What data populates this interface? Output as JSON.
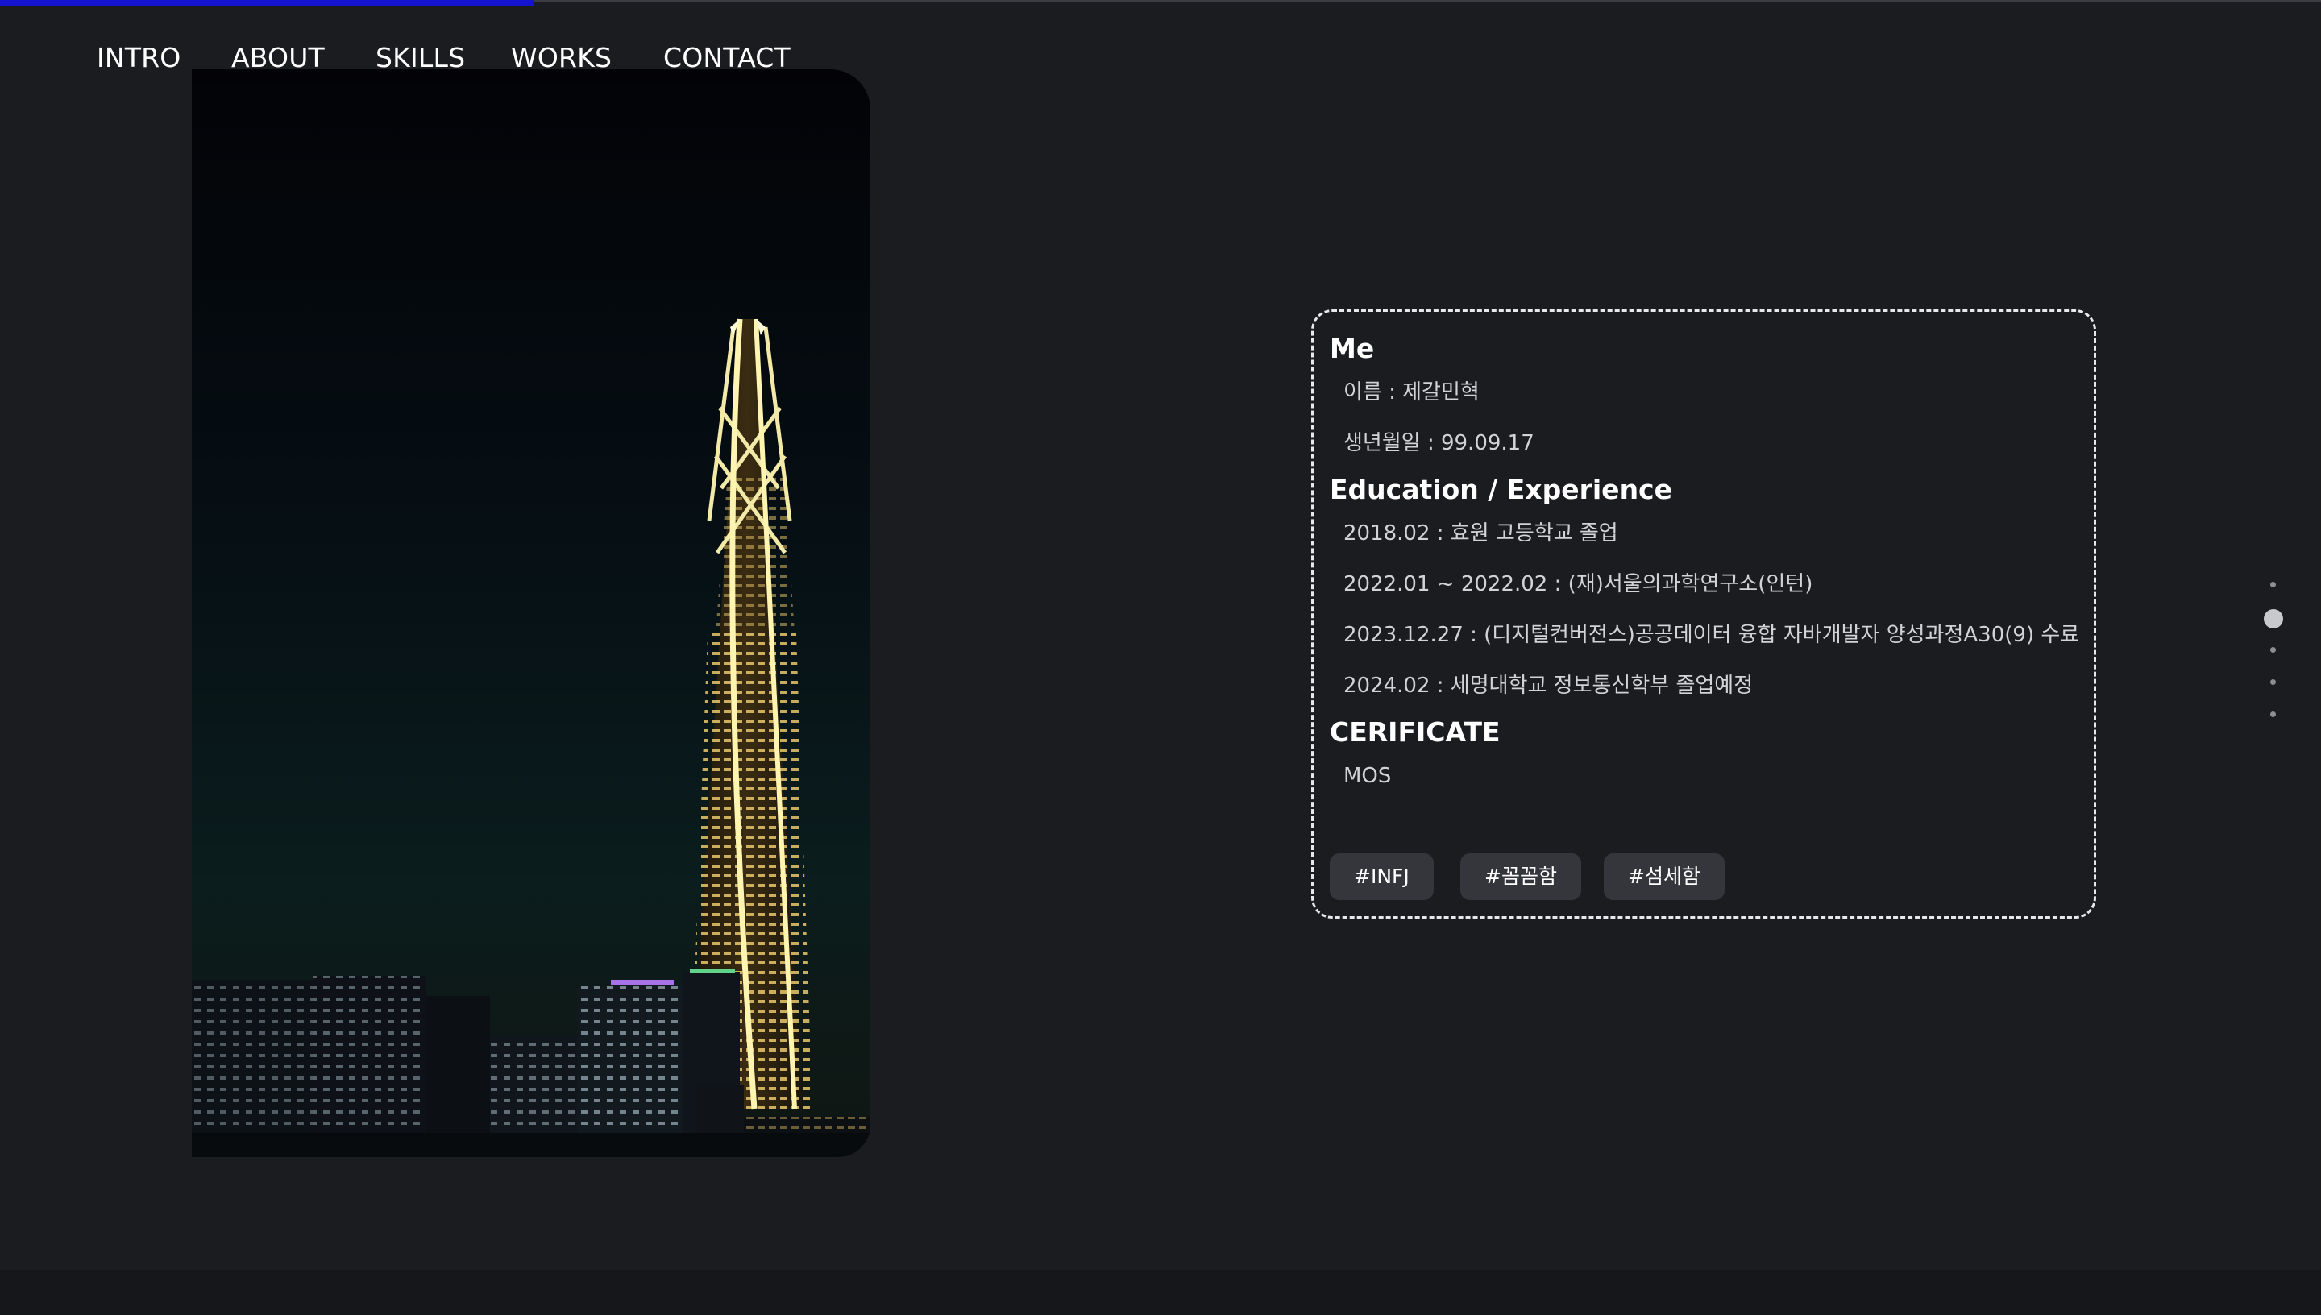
{
  "progress": {
    "value_percent": 23,
    "color": "#1414d0"
  },
  "nav": {
    "items": [
      {
        "label": "INTRO",
        "active": false
      },
      {
        "label": "ABOUT",
        "active": true
      },
      {
        "label": "SKILLS",
        "active": false
      },
      {
        "label": "WORKS",
        "active": false
      },
      {
        "label": "CONTACT",
        "active": false
      }
    ]
  },
  "photo": {
    "icon": "night-skyline-photo"
  },
  "about": {
    "me": {
      "title": "Me",
      "name": "이름 : 제갈민혁",
      "birth": "생년월일 : 99.09.17"
    },
    "education": {
      "title": "Education / Experience",
      "items": [
        "2018.02 : 효원 고등학교 졸업",
        "2022.01 ~ 2022.02 : (재)서울의과학연구소(인턴)",
        "2023.12.27 : (디지털컨버전스)공공데이터 융합 자바개발자 양성과정A30(9) 수료",
        "2024.02 : 세명대학교 정보통신학부 졸업예정"
      ]
    },
    "certificate": {
      "title": "CERIFICATE",
      "items": [
        "MOS"
      ]
    },
    "tags": [
      "#INFJ",
      "#꼼꼼함",
      "#섬세함"
    ]
  },
  "pagination": {
    "total": 5,
    "active_index": 1
  }
}
